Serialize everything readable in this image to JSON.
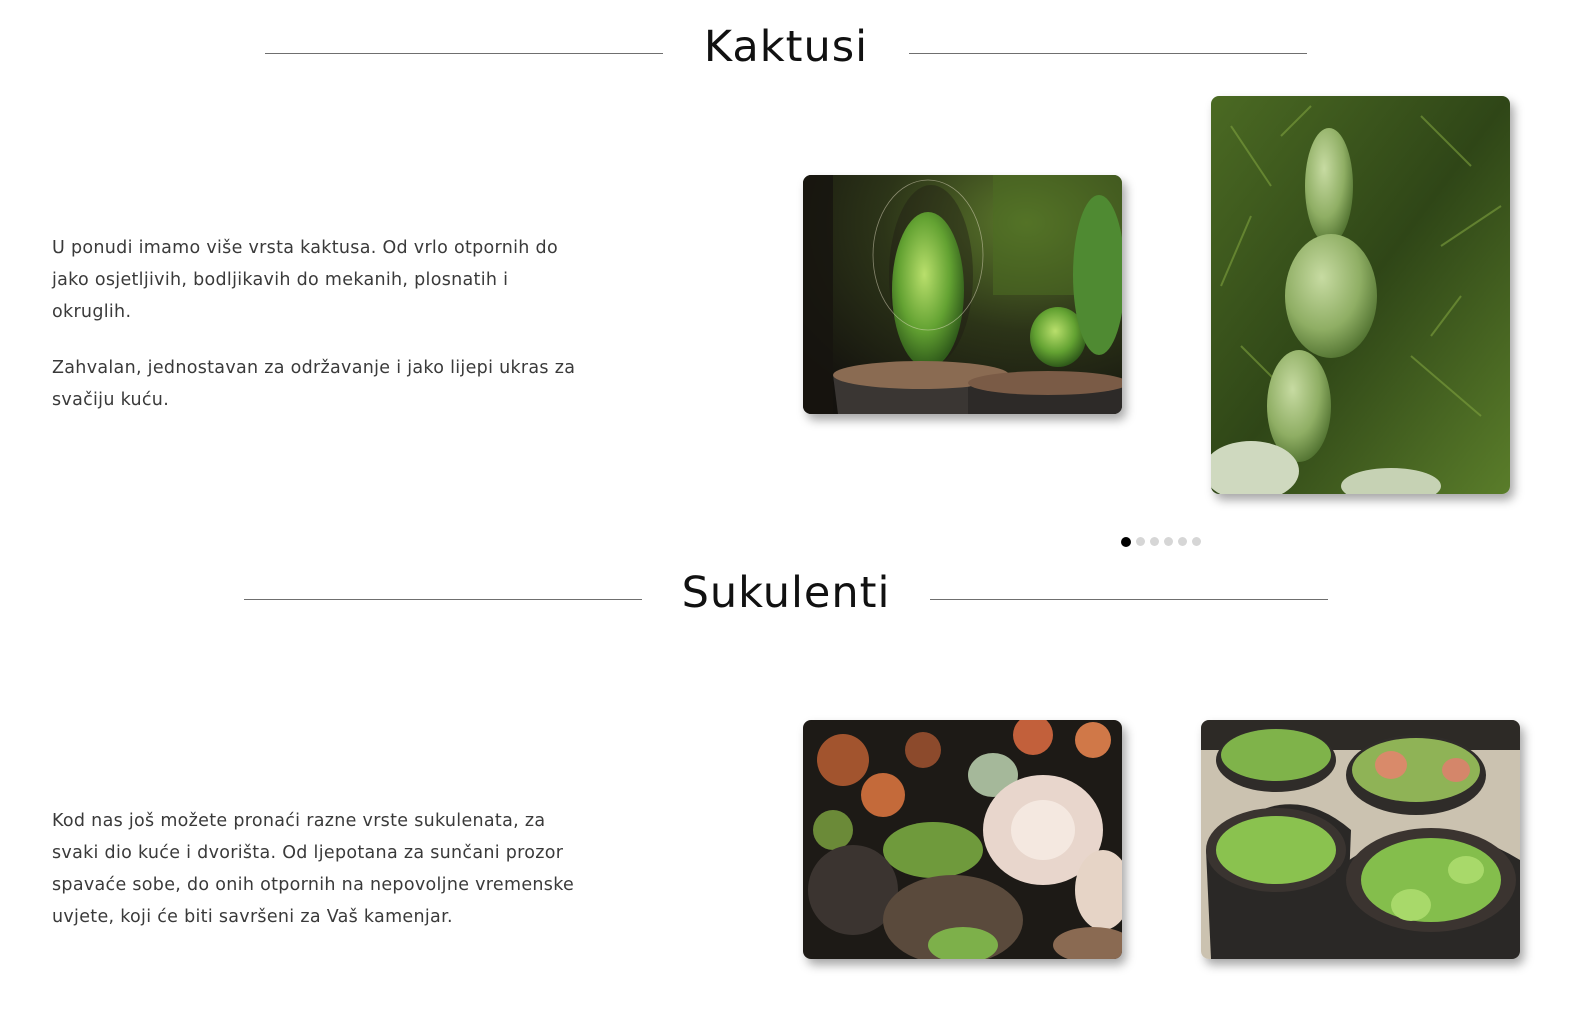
{
  "sections": [
    {
      "title": "Kaktusi",
      "paragraphs": [
        "U ponudi imamo više vrsta kaktusa. Od vrlo otpornih do jako osjetljivih, bodljikavih do mekanih, plosnatih i okruglih.",
        "Zahvalan, jednostavan za održavanje i jako lijepi ukras za svačiju kuću."
      ],
      "images": [
        "cactus-pots-photo",
        "bunny-ear-cactus-photo"
      ]
    },
    {
      "title": "Sukulenti",
      "paragraphs": [
        "Kod nas još možete pronaći razne vrste sukulenata, za svaki dio kuće i dvorišta. Od ljepotana za sunčani prozor spavaće sobe, do onih otpornih na nepovoljne vremenske uvjete, koji će biti savršeni za Vaš kamenjar."
      ],
      "images": [
        "succulent-mix-photo",
        "succulent-pots-photo"
      ]
    }
  ],
  "carousel": {
    "slide_count": 6,
    "active_slide": 1
  },
  "colors": {
    "background": "#ffffff",
    "heading": "#111111",
    "text": "#3a3a3a",
    "rule": "#6f6f6f",
    "dot_active": "#000000",
    "dot_inactive": "#d6d6d6"
  }
}
